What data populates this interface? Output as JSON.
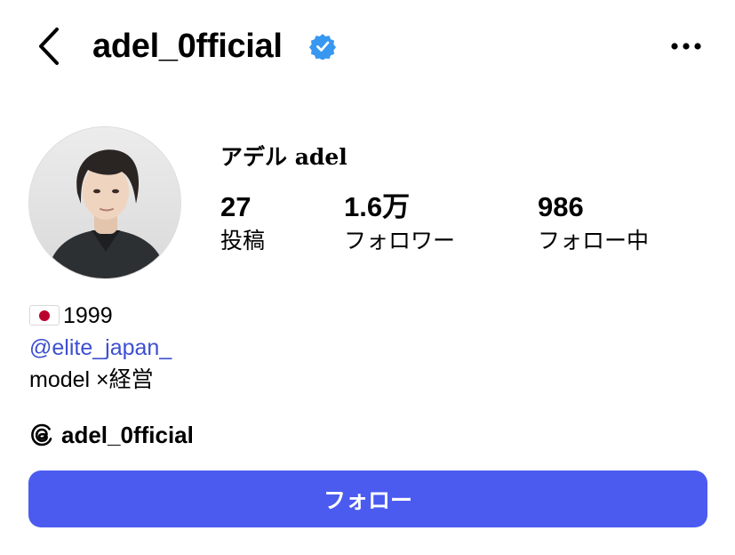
{
  "header": {
    "username": "adel_0fficial",
    "verified": true,
    "back_icon": "chevron-left-icon",
    "more_icon": "more-horizontal-icon",
    "badge_color": "#3897f0"
  },
  "profile": {
    "display_name": "アデル adel",
    "avatar_icon": "profile-photo"
  },
  "stats": [
    {
      "value": "27",
      "label": "投稿"
    },
    {
      "value": "1.6万",
      "label": "フォロワー"
    },
    {
      "value": "986",
      "label": "フォロー中"
    }
  ],
  "bio": {
    "flag_icon": "japan-flag-icon",
    "line1": "1999",
    "mention": "@elite_japan_",
    "line3": "model ×経営"
  },
  "threads": {
    "icon": "threads-icon",
    "handle": "adel_0fficial"
  },
  "actions": {
    "follow_label": "フォロー",
    "follow_color": "#4b5bf0"
  },
  "colors": {
    "link": "#3d4fcf",
    "text": "#000000",
    "background": "#ffffff"
  }
}
